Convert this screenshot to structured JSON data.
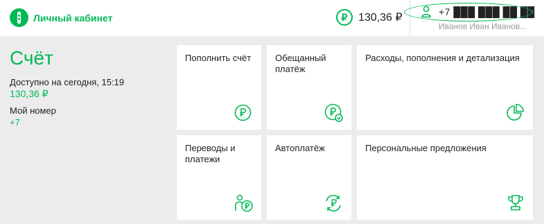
{
  "header": {
    "logo_text": "Личный кабинет",
    "balance_symbol": "₽",
    "balance": "130,36 ₽",
    "account_phone": "+7 ███ ███ ██ ██",
    "account_name": "Иванов Иван Иванов..."
  },
  "sidebar": {
    "title": "Счёт",
    "available_label": "Доступно на сегодня, 15:19",
    "available_value": "130,36 ₽",
    "my_number_label": "Мой номер",
    "my_number_value": "+7"
  },
  "tiles": [
    {
      "label": "Пополнить счёт",
      "icon": "ruble-icon"
    },
    {
      "label": "Обещанный платёж",
      "icon": "ruble-check-icon"
    },
    {
      "label": "Расходы, пополнения и детализация",
      "icon": "pie-chart-icon"
    },
    {
      "label": "Переводы и платежи",
      "icon": "person-ruble-icon"
    },
    {
      "label": "Автоплатёж",
      "icon": "ruble-cycle-icon"
    },
    {
      "label": "Персональные предложения",
      "icon": "trophy-icon"
    }
  ],
  "colors": {
    "accent": "#00b956",
    "background": "#ececec",
    "tile": "#ffffff"
  }
}
